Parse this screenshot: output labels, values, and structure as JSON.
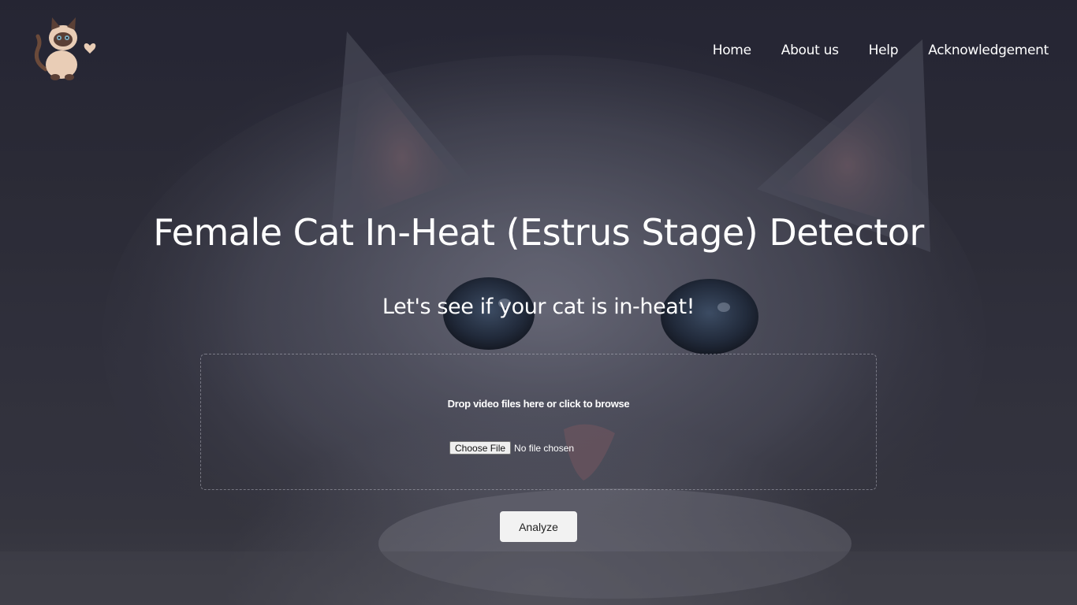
{
  "nav": {
    "items": [
      {
        "label": "Home"
      },
      {
        "label": "About us"
      },
      {
        "label": "Help"
      },
      {
        "label": "Acknowledgement"
      }
    ]
  },
  "logo": {
    "icon": "cat-mascot-icon"
  },
  "hero": {
    "title": "Female Cat In-Heat (Estrus Stage) Detector",
    "subtitle": "Let's see if your cat is in-heat!"
  },
  "upload": {
    "dropzone_label": "Drop video files here or click to browse",
    "choose_file_label": "Choose File",
    "file_status": "No file chosen"
  },
  "actions": {
    "analyze_label": "Analyze"
  },
  "colors": {
    "background": "#34343f",
    "text": "#ffffff",
    "button": "#f2f2f2"
  }
}
